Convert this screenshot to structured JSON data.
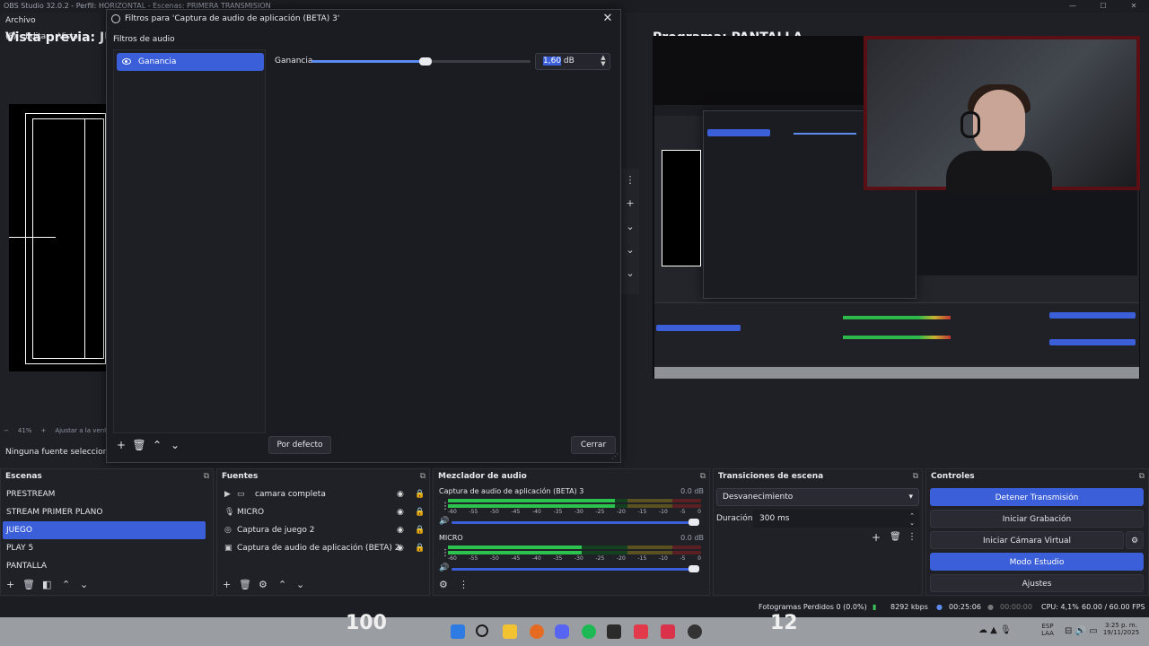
{
  "window": {
    "title": "OBS Studio 32.0.2 - Perfil: HORIZONTAL - Escenas: PRIMERA TRANSMISION"
  },
  "menu": [
    "Archivo (F)",
    "Editar",
    "Vista"
  ],
  "preview": {
    "title": "Vista previa: JUEGO",
    "zoom": "41%",
    "fit_label": "Ajustar a la ventana"
  },
  "program": {
    "title": "Programa: PANTALLA"
  },
  "dialog": {
    "title": "Filtros para 'Captura de audio de aplicación (BETA) 3'",
    "section_label": "Filtros de audio",
    "filters": [
      {
        "name": "Ganancia",
        "visible": true
      }
    ],
    "property_label": "Ganancia",
    "gain_fraction": 0.52,
    "gain_value": "1,60",
    "gain_unit": " dB",
    "default_button": "Por defecto",
    "close_button": "Cerrar"
  },
  "status_source": "Ninguna fuente seleccionada",
  "scenes": {
    "title": "Escenas",
    "items": [
      "PRESTREAM",
      "STREAM PRIMER PLANO",
      "JUEGO",
      "PLAY 5",
      "PANTALLA"
    ],
    "selected_index": 2
  },
  "sources": {
    "title": "Fuentes",
    "items": [
      {
        "name": "camara completa",
        "icon": "folder-icon"
      },
      {
        "name": "MICRO",
        "icon": "mic-icon"
      },
      {
        "name": "Captura de juego 2",
        "icon": "gamepad-icon"
      },
      {
        "name": "Captura de audio de aplicación (BETA) 2",
        "icon": "window-audio-icon"
      }
    ]
  },
  "mixer": {
    "title": "Mezclador de audio",
    "channels": [
      {
        "name": "Captura de audio de aplicación (BETA) 3",
        "db": "0.0 dB",
        "level": 0.66
      },
      {
        "name": "MICRO",
        "db": "0.0 dB",
        "level": 0.53
      }
    ],
    "ticks": [
      "-60",
      "-55",
      "-50",
      "-45",
      "-40",
      "-35",
      "-30",
      "-25",
      "-20",
      "-15",
      "-10",
      "-5",
      "0"
    ]
  },
  "transitions": {
    "title": "Transiciones de escena",
    "selected": "Desvanecimiento",
    "duration_label": "Duración",
    "duration_value": "300 ms"
  },
  "controls": {
    "title": "Controles",
    "buttons": [
      {
        "label": "Detener Transmisión",
        "active": true
      },
      {
        "label": "Iniciar Grabación",
        "active": false
      },
      {
        "label": "Iniciar Cámara Virtual",
        "active": false
      },
      {
        "label": "Modo Estudio",
        "active": true
      },
      {
        "label": "Ajustes",
        "active": false
      }
    ]
  },
  "statusbar": {
    "dropped": "Fotogramas Perdidos 0 (0.0%)",
    "bitrate": "8292 kbps",
    "stream_time": "00:25:06",
    "rec_time": "00:00:00",
    "cpu": "CPU: 4,1%",
    "fps": "60.00 / 60.00 FPS"
  },
  "taskbar": {
    "lang": "ESP",
    "layout": "LAA",
    "time": "3:25 p. m.",
    "date": "19/11/2025",
    "score_left": "100",
    "score_right": "12"
  },
  "colors": {
    "accent": "#3b5fd9",
    "bg": "#1f2026",
    "dock": "#202127"
  }
}
